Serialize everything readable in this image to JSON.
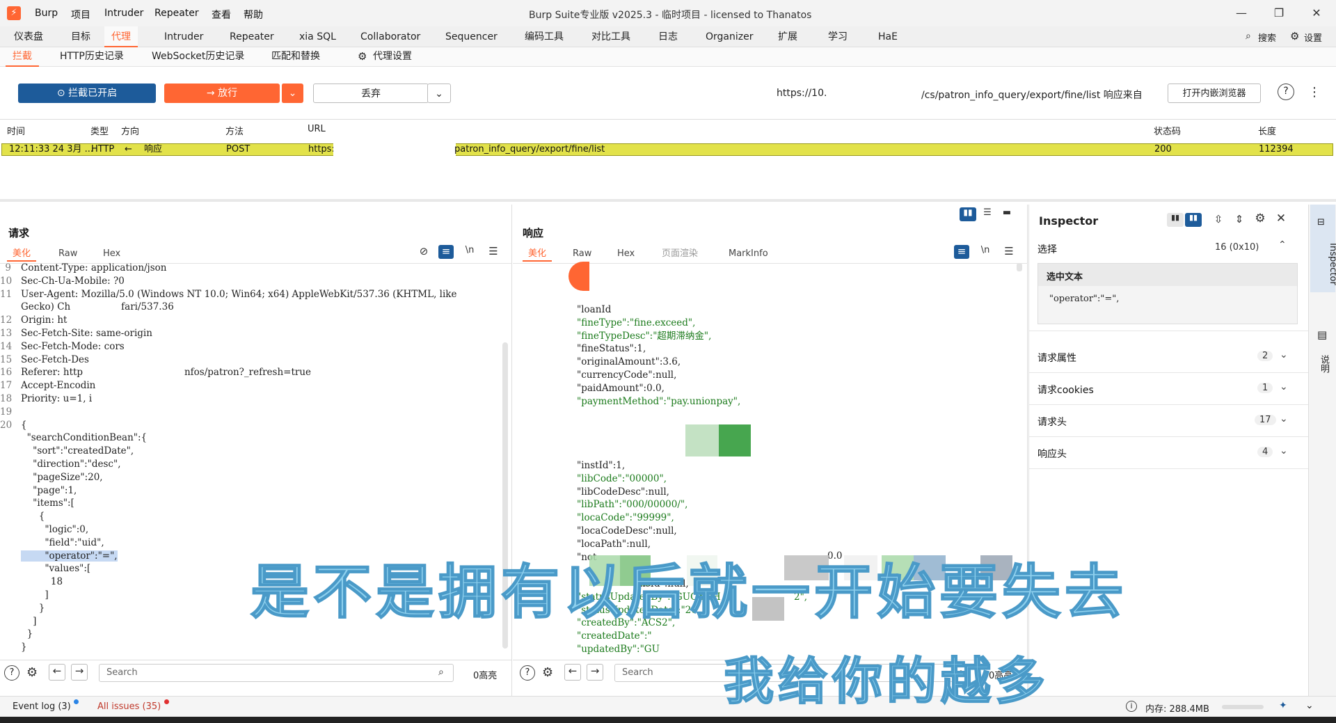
{
  "titlebar": {
    "menus": [
      "Burp",
      "项目",
      "Intruder",
      "Repeater",
      "查看",
      "帮助"
    ],
    "title": "Burp Suite专业版  v2025.3 - 临时项目 - licensed to Thanatos",
    "minimize": "—",
    "maximize": "❐",
    "close": "✕"
  },
  "main_tabs": [
    "仪表盘",
    "目标",
    "代理",
    "Intruder",
    "Repeater",
    "xia SQL",
    "Collaborator",
    "Sequencer",
    "编码工具",
    "对比工具",
    "日志",
    "Organizer",
    "扩展",
    "学习",
    "HaE"
  ],
  "main_tabs_active": "代理",
  "top_right": {
    "search": "搜索",
    "settings": "设置"
  },
  "sub_tabs": [
    "拦截",
    "HTTP历史记录",
    "WebSocket历史记录",
    "匹配和替换",
    "代理设置"
  ],
  "toolbar": {
    "intercept": "拦截已开启",
    "forward": "放行",
    "drop": "丢弃",
    "url_left": "https://10.",
    "url_right": "/cs/patron_info_query/export/fine/list 响应来自",
    "open_browser": "打开内嵌浏览器"
  },
  "history": {
    "columns": [
      "时间",
      "类型",
      "方向",
      "方法",
      "URL",
      "状态码",
      "长度"
    ],
    "row": {
      "time": "12:11:33 24 3月 ...",
      "type": "HTTP",
      "dir_arrow": "←",
      "dir": "响应",
      "method": "POST",
      "url_left": "https:",
      "url_right": "patron_info_query/export/fine/list",
      "status": "200",
      "length": "112394"
    }
  },
  "request": {
    "title": "请求",
    "tabs": [
      "美化",
      "Raw",
      "Hex"
    ],
    "line_numbers": [
      "9",
      "10",
      "11",
      "",
      "12",
      "13",
      "14",
      "15",
      "16",
      "17",
      "18",
      "19",
      "20"
    ],
    "lines": [
      "Content-Type: application/json",
      "Sec-Ch-Ua-Mobile: ?0",
      "User-Agent: Mozilla/5.0 (Windows NT 10.0; Win64; x64) AppleWebKit/537.36 (KHTML, like",
      "Gecko) Ch                 fari/537.36",
      "Origin: ht",
      "Sec-Fetch-Site: same-origin",
      "Sec-Fetch-Mode: cors",
      "Sec-Fetch-Des",
      "Referer: http                                  nfos/patron?_refresh=true",
      "Accept-Encodin",
      "Priority: u=1, i",
      "",
      "{"
    ],
    "json_lines": [
      "  \"searchConditionBean\":{",
      "    \"sort\":\"createdDate\",",
      "    \"direction\":\"desc\",",
      "    \"pageSize\":20,",
      "    \"page\":1,",
      "    \"items\":[",
      "      {",
      "        \"logic\":0,",
      "        \"field\":\"uid\",",
      "        \"operator\":\"=\",",
      "        \"values\":[",
      "          18",
      "        ]",
      "      }",
      "    ]",
      "  }",
      "}"
    ],
    "icons": {
      "hide": "⊘",
      "wrap": "≡",
      "newline": "\\n",
      "menu": "☰"
    },
    "search_placeholder": "Search",
    "highlights": "0高亮"
  },
  "response": {
    "title": "响应",
    "tabs": [
      "美化",
      "Raw",
      "Hex",
      "页面渲染",
      "MarkInfo"
    ],
    "lines_a": [
      "\"loanId",
      "\"fineType\":\"fine.exceed\",",
      "\"fineTypeDesc\":\"超期滞纳金\",",
      "\"fineStatus\":1,",
      "\"originalAmount\":3.6,",
      "\"currencyCode\":null,",
      "\"paidAmount\":0.0,",
      "\"paymentMethod\":\"pay.unionpay\","
    ],
    "lines_b": [
      "\"instId\":1,",
      "\"libCode\":\"00000\",",
      "\"libCodeDesc\":null,",
      "\"libPath\":\"000/00000/\",",
      "\"locaCode\":\"99999\",",
      "\"locaCodeDesc\":null,",
      "\"locaPath\":null,",
      "\"not"
    ],
    "lines_c": [
      "ansId\":null,",
      "\"statusUpdatedBy\":\"GUOXUH",
      "\"statusUpdatedDate\":\"20",
      "\"createdBy\":\"ACS2\",",
      "\"createdDate\":\"",
      "\"updatedBy\":\"GU"
    ],
    "fragment_1": "0.0",
    "fragment_2": "2\",",
    "search_placeholder": "Search",
    "highlights": "0高亮"
  },
  "inspector": {
    "title": "Inspector",
    "selection_label": "选择",
    "selection_count": "16 (0x10)",
    "selected_text_title": "选中文本",
    "selected_text": "\"operator\":\"=\",",
    "rows": [
      {
        "label": "请求属性",
        "count": "2"
      },
      {
        "label": "请求cookies",
        "count": "1"
      },
      {
        "label": "请求头",
        "count": "17"
      },
      {
        "label": "响应头",
        "count": "4"
      }
    ]
  },
  "side_strip": {
    "inspector": "Inspector",
    "notes": "说明"
  },
  "statusbar": {
    "event_log": "Event log (3)",
    "issues": "All issues (35)",
    "memory": "内存: 288.4MB"
  },
  "captions": {
    "line1": "是不是拥有以后就一开始要失去",
    "line2": "我给你的越多"
  },
  "colors": {
    "accent": "#ff6633",
    "blue": "#1d5b9a",
    "highlight_row": "#e2e24a",
    "caption": "#8ed0ee"
  }
}
